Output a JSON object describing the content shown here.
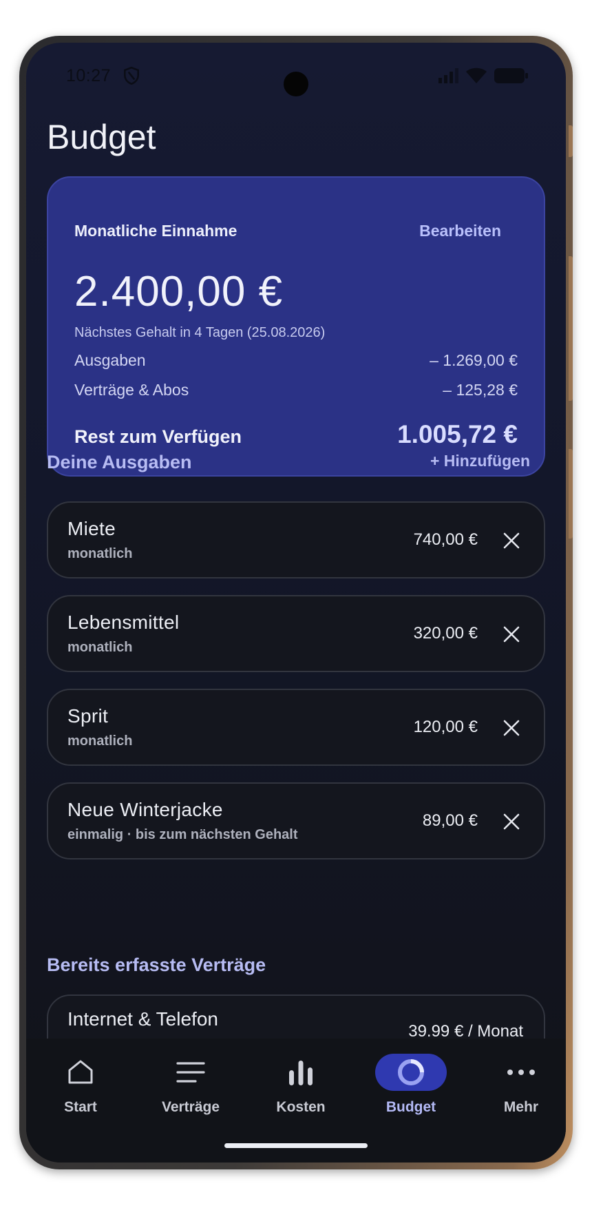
{
  "status_bar": {
    "time": "10:27"
  },
  "page": {
    "title": "Budget"
  },
  "income": {
    "label": "Monatliche Einnahme",
    "edit_label": "Bearbeiten",
    "amount": "2.400,00 €",
    "next_salary": "Nächstes Gehalt in 4 Tagen (25.08.2026)",
    "expenses_label": "Ausgaben",
    "expenses_value": "– 1.269,00 €",
    "contracts_label": "Verträge & Abos",
    "contracts_value": "– 125,28 €",
    "rest_label": "Rest zum Verfügen",
    "rest_value": "1.005,72 €"
  },
  "expenses_section": {
    "title": "Deine Ausgaben",
    "add_label": "+ Hinzufügen",
    "items": [
      {
        "name": "Miete",
        "frequency": "monatlich",
        "amount": "740,00 €"
      },
      {
        "name": "Lebensmittel",
        "frequency": "monatlich",
        "amount": "320,00 €"
      },
      {
        "name": "Sprit",
        "frequency": "monatlich",
        "amount": "120,00 €"
      },
      {
        "name": "Neue Winterjacke",
        "frequency": "einmalig · bis zum nächsten Gehalt",
        "amount": "89,00 €"
      }
    ]
  },
  "contracts_section": {
    "title": "Bereits erfasste Verträge",
    "items": [
      {
        "name": "Internet & Telefon",
        "price": "39.99 € / Monat"
      }
    ]
  },
  "nav": {
    "items": [
      {
        "label": "Start",
        "icon": "home-icon"
      },
      {
        "label": "Verträge",
        "icon": "list-icon"
      },
      {
        "label": "Kosten",
        "icon": "bar-chart-icon"
      },
      {
        "label": "Budget",
        "icon": "donut-icon",
        "active": true
      },
      {
        "label": "Mehr",
        "icon": "more-icon"
      }
    ]
  },
  "colors": {
    "background": "#13172a",
    "card_accent": "#2b3286",
    "nav_active": "#2f39b0",
    "accent_text": "#b7bcf3"
  }
}
